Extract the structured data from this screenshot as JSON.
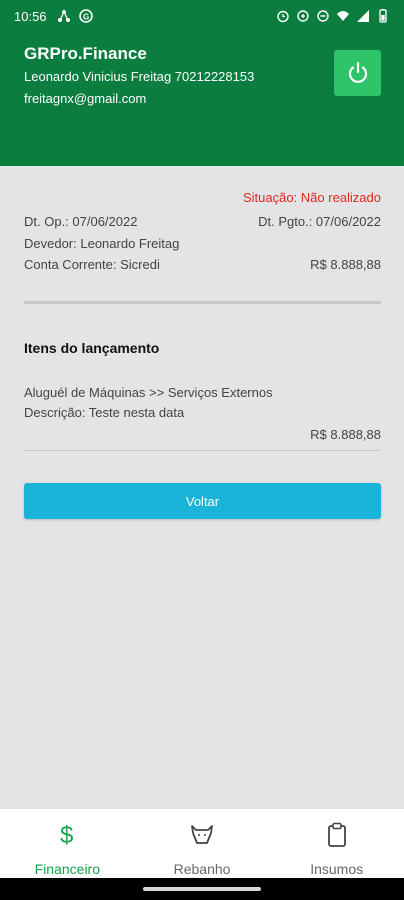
{
  "statusbar": {
    "time": "10:56"
  },
  "header": {
    "app_title": "GRPro.Finance",
    "user_line": "Leonardo Vinicius Freitag 70212228153",
    "email": "freitagnx@gmail.com",
    "bg_color": "#0b7d3f",
    "power_button_color": "#2fc36a"
  },
  "details": {
    "situacao": "Situação: Não realizado",
    "dt_op": "Dt. Op.: 07/06/2022",
    "dt_pgto": "Dt. Pgto.: 07/06/2022",
    "devedor": "Devedor: Leonardo Freitag",
    "conta_corrente": "Conta Corrente: Sicredi",
    "valor": "R$ 8.888,88"
  },
  "itens": {
    "title": "Itens do lançamento",
    "item_categoria": "Aluguél de Máquinas >> Serviços Externos",
    "item_descricao": "Descrição: Teste nesta data",
    "item_valor": "R$ 8.888,88"
  },
  "actions": {
    "voltar_label": "Voltar",
    "voltar_color": "#1ab4d8"
  },
  "bottom_nav": {
    "items": [
      {
        "label": "Financeiro",
        "icon": "dollar-icon",
        "active": true
      },
      {
        "label": "Rebanho",
        "icon": "cow-icon",
        "active": false
      },
      {
        "label": "Insumos",
        "icon": "clipboard-icon",
        "active": false
      }
    ],
    "active_color": "#16a34a"
  }
}
